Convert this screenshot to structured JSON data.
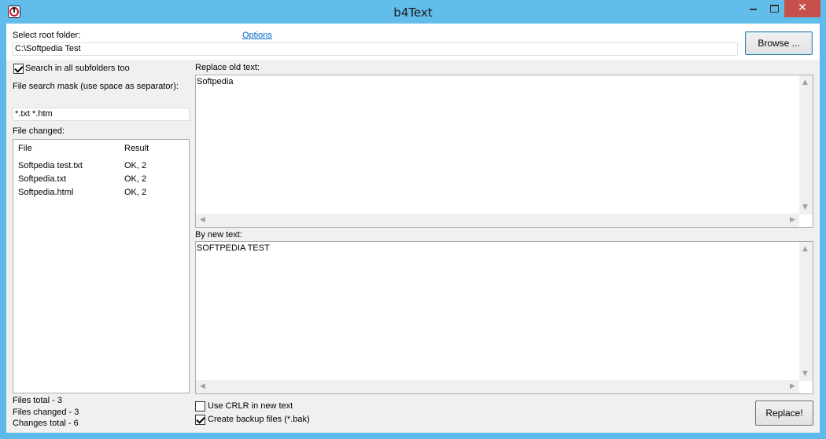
{
  "window": {
    "title": "b4Text",
    "close_glyph": "✕"
  },
  "icons": {
    "app": "app-logo-icon",
    "minimize": "minimize-icon",
    "maximize": "maximize-icon",
    "close": "close-icon",
    "scroll_up": "▲",
    "scroll_down": "▼",
    "scroll_left": "◀",
    "scroll_right": "▶"
  },
  "app_icon_letter": "T",
  "root_folder": {
    "label": "Select root folder:",
    "options_link": "Options",
    "value": "C:\\Softpedia Test",
    "browse_label": "Browse ..."
  },
  "search": {
    "subfolders_label": "Search in all subfolders too",
    "subfolders_checked": true,
    "mask_label": "File search mask (use space as separator):",
    "mask_value": "*.txt *.htm"
  },
  "file_changed": {
    "label": "File changed:",
    "columns": [
      "File",
      "Result"
    ],
    "rows": [
      {
        "file": "Softpedia test.txt",
        "result": "OK, 2"
      },
      {
        "file": "Softpedia.txt",
        "result": "OK, 2"
      },
      {
        "file": "Softpedia.html",
        "result": "OK, 2"
      }
    ]
  },
  "replace_old": {
    "label": "Replace old text:",
    "value": "Softpedia"
  },
  "replace_new": {
    "label": "By new text:",
    "value": "SOFTPEDIA TEST"
  },
  "status": {
    "files_total": "Files total - 3",
    "files_changed": "Files changed - 3",
    "changes_total": "Changes total - 6"
  },
  "options": {
    "crlr_label": "Use CRLR in new text",
    "crlr_checked": false,
    "backup_label": "Create backup files (*.bak)",
    "backup_checked": true
  },
  "replace_button": "Replace!",
  "colors": {
    "titlebar": "#62bdeb",
    "close_button": "#c7504b",
    "link": "#0066cc"
  }
}
